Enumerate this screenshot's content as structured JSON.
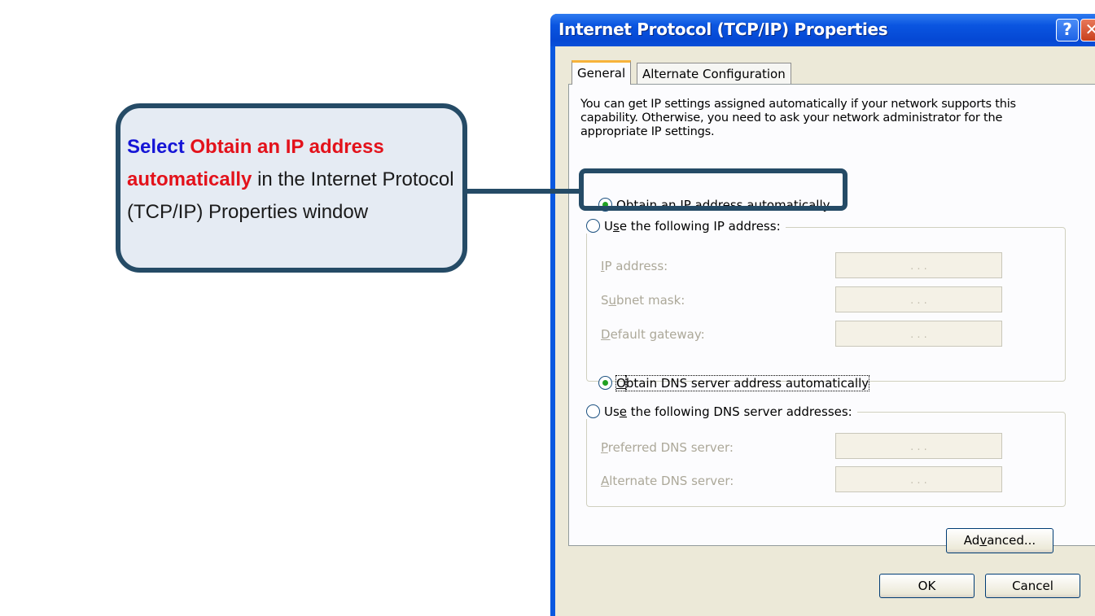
{
  "callout": {
    "part1": "Select",
    "part2": "Obtain an IP address automatically",
    "part3": "in the Internet Protocol (TCP/IP) Properties window"
  },
  "window": {
    "title": "Internet Protocol (TCP/IP) Properties",
    "help_label": "?",
    "close_label": "✕"
  },
  "tabs": [
    {
      "label": "General",
      "active": true
    },
    {
      "label": "Alternate Configuration",
      "active": false
    }
  ],
  "description": "You can get IP settings assigned automatically if your network supports this capability. Otherwise, you need to ask your network administrator for the appropriate IP settings.",
  "ip_options": {
    "auto": {
      "prefix": "",
      "mnemonic": "O",
      "rest": "btain an IP address automatically",
      "selected": true
    },
    "manual": {
      "prefix": "U",
      "mnemonic": "s",
      "rest": "e the following IP address:",
      "selected": false
    }
  },
  "ip_fields": [
    {
      "prefix": "",
      "mnemonic": "I",
      "rest": "P address:",
      "value": ". . ."
    },
    {
      "prefix": "S",
      "mnemonic": "u",
      "rest": "bnet mask:",
      "value": ". . ."
    },
    {
      "prefix": "",
      "mnemonic": "D",
      "rest": "efault gateway:",
      "value": ". . ."
    }
  ],
  "dns_options": {
    "auto": {
      "prefix": "",
      "mnemonic": "O",
      "rest": "btain DNS server address automatically",
      "selected": true
    },
    "manual": {
      "prefix": "Us",
      "mnemonic": "e",
      "rest": " the following DNS server addresses:",
      "selected": false
    }
  },
  "dns_fields": [
    {
      "prefix": "",
      "mnemonic": "P",
      "rest": "referred DNS server:",
      "value": ". . ."
    },
    {
      "prefix": "",
      "mnemonic": "A",
      "rest": "lternate DNS server:",
      "value": ". . ."
    }
  ],
  "buttons": {
    "advanced": {
      "prefix": "Ad",
      "mnemonic": "v",
      "rest": "anced..."
    },
    "ok": "OK",
    "cancel": "Cancel"
  }
}
